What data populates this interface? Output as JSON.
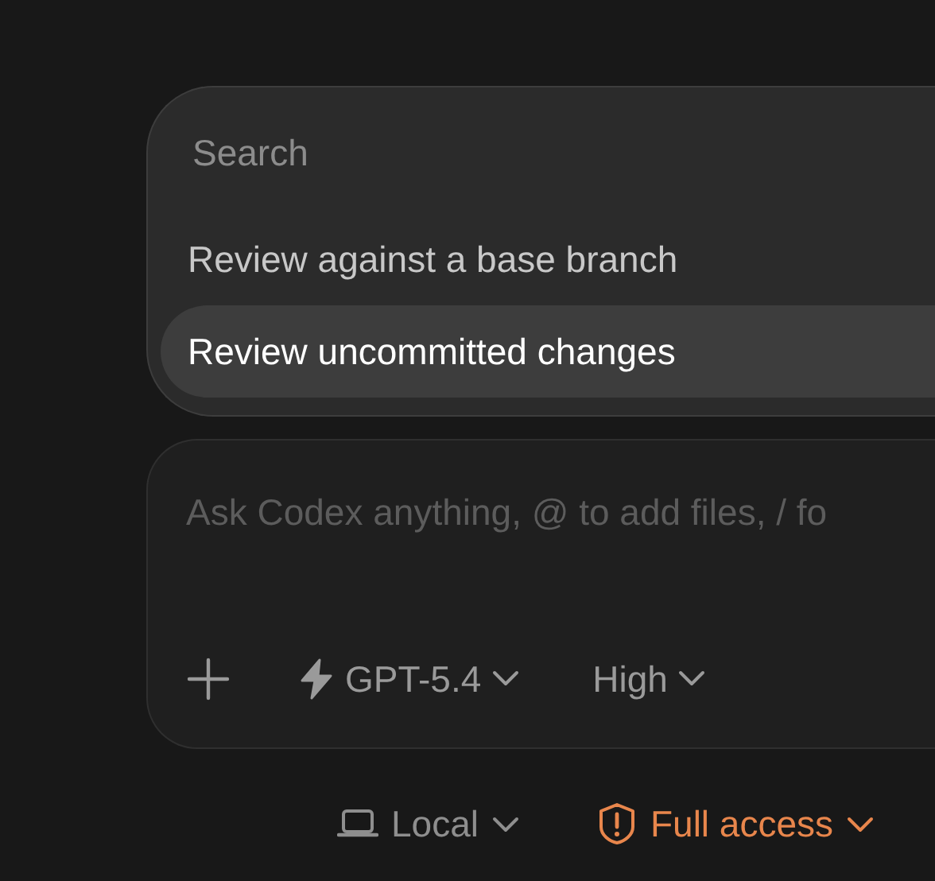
{
  "menu": {
    "search": {
      "placeholder": "Search"
    },
    "items": [
      {
        "label": "Review against a base branch",
        "selected": false
      },
      {
        "label": "Review uncommitted changes",
        "selected": true
      }
    ]
  },
  "composer": {
    "placeholder": "Ask Codex anything, @ to add files, / fo",
    "model": "GPT-5.4",
    "effort": "High"
  },
  "footer": [
    {
      "kind": "local",
      "label": "Local"
    },
    {
      "kind": "access",
      "label": "Full access"
    }
  ]
}
